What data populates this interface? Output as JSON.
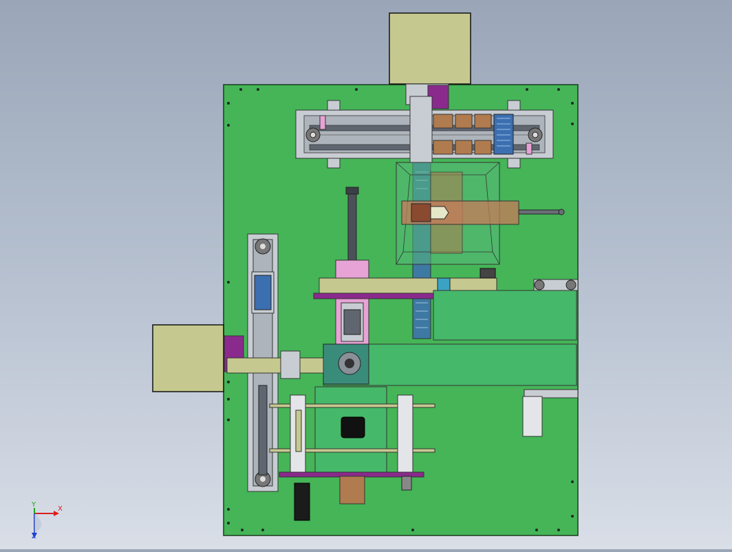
{
  "viewport": {
    "background_top": "#9aa6b8",
    "background_bottom": "#d9dee7"
  },
  "model": {
    "base_plate_color": "#45b557",
    "motor_box_color": "#c5c98f",
    "frame_color": "#c8cdd3",
    "rail_color": "#5f6670",
    "brown_block_color": "#b07b4e",
    "pink_color": "#e7a3d5",
    "purple_color": "#8a2a8c",
    "blue_color": "#3c6fb0",
    "belt_color": "#46b86a",
    "clear_cover_color": "#56b87a"
  },
  "triad": {
    "x_label": "X",
    "y_label": "Y",
    "z_label": "Z",
    "x_color": "#d81f1f",
    "y_color": "#1aa61a",
    "z_color": "#2040d0"
  }
}
